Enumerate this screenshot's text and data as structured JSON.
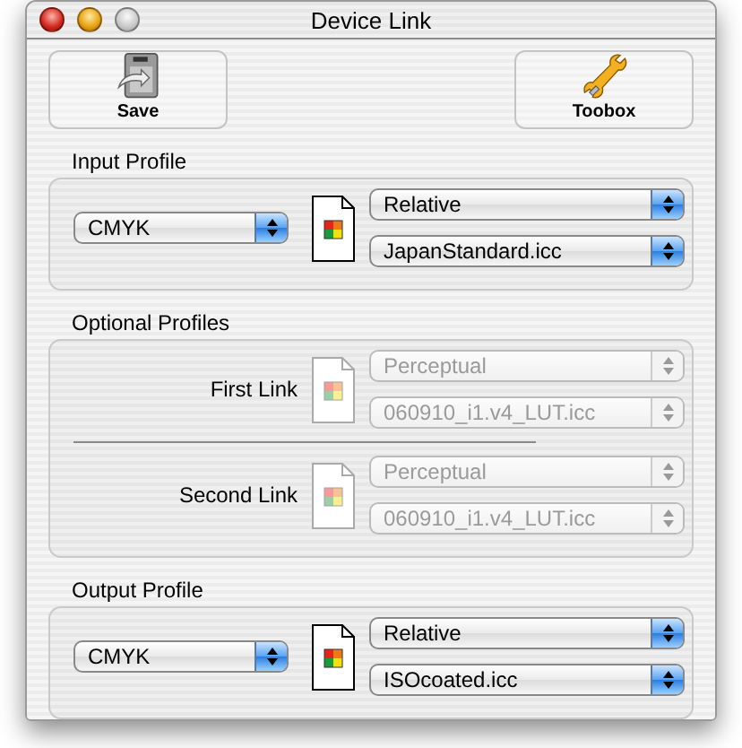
{
  "window": {
    "title": "Device Link"
  },
  "toolbar": [
    {
      "label": "Save",
      "kind": "save"
    },
    {
      "label": "Toobox",
      "kind": "toolbox"
    }
  ],
  "input_profile": {
    "title": "Input Profile",
    "colorspace": "CMYK",
    "intent": "Relative",
    "profile": "JapanStandard.icc"
  },
  "optional_profiles": {
    "title": "Optional Profiles",
    "links": [
      {
        "label": "First Link",
        "intent": "Perceptual",
        "profile": "060910_i1.v4_LUT.icc",
        "disabled": true
      },
      {
        "label": "Second Link",
        "intent": "Perceptual",
        "profile": "060910_i1.v4_LUT.icc",
        "disabled": true
      }
    ]
  },
  "output_profile": {
    "title": "Output Profile",
    "colorspace": "CMYK",
    "intent": "Relative",
    "profile": "ISOcoated.icc"
  }
}
